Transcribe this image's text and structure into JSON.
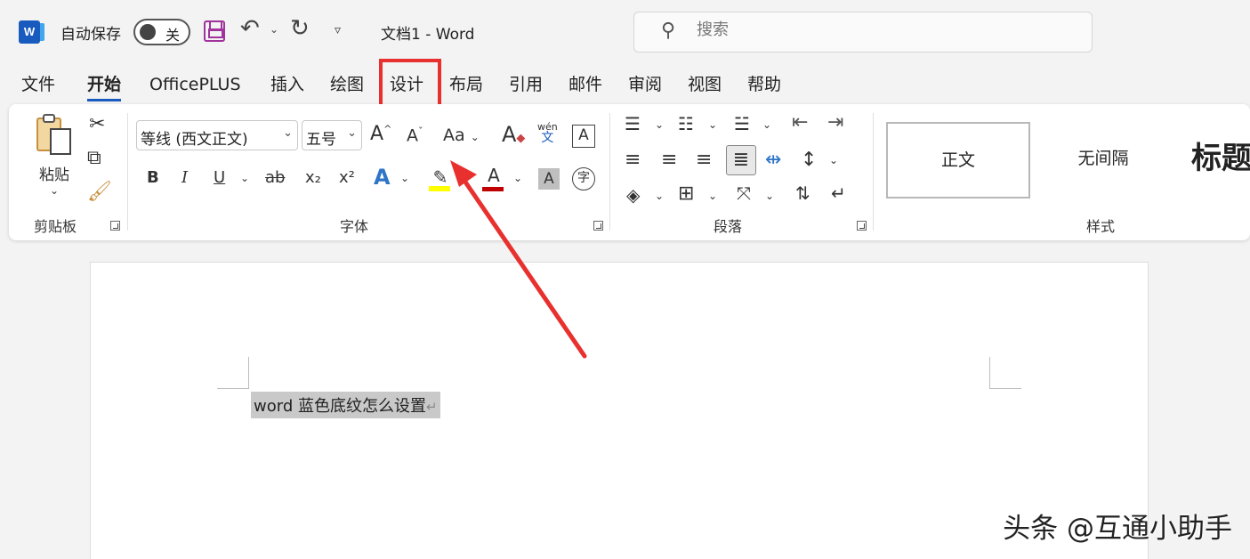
{
  "titlebar": {
    "autosave_label": "自动保存",
    "autosave_state": "关",
    "doc_title": "文档1 - Word",
    "search_placeholder": "搜索",
    "logo_letter": "W"
  },
  "tabs": [
    "文件",
    "开始",
    "OfficePLUS",
    "插入",
    "绘图",
    "设计",
    "布局",
    "引用",
    "邮件",
    "审阅",
    "视图",
    "帮助"
  ],
  "ribbon": {
    "clipboard": {
      "paste_label": "粘贴",
      "group_label": "剪贴板"
    },
    "font": {
      "font_name": "等线 (西文正文)",
      "font_size": "五号",
      "group_label": "字体",
      "phonetic_top": "wén",
      "phonetic_bottom": "文",
      "bold": "B",
      "italic": "I",
      "underline": "U",
      "strike": "ab",
      "subscript": "x₂",
      "superscript": "x²",
      "effects": "A",
      "font_color": "A",
      "char_shading": "A",
      "enclose": "字",
      "grow": "A",
      "shrink": "A",
      "case": "Aa",
      "clear": "A",
      "border": "A"
    },
    "paragraph": {
      "group_label": "段落"
    },
    "styles": {
      "group_label": "样式",
      "items": [
        "正文",
        "无间隔",
        "标题"
      ]
    }
  },
  "document": {
    "text": "word 蓝色底纹怎么设置",
    "mark": "↵"
  },
  "watermark": "头条 @互通小助手",
  "colors": {
    "accent": "#185abd",
    "highlight_box": "#e8312f",
    "arrow": "#e8312f"
  }
}
